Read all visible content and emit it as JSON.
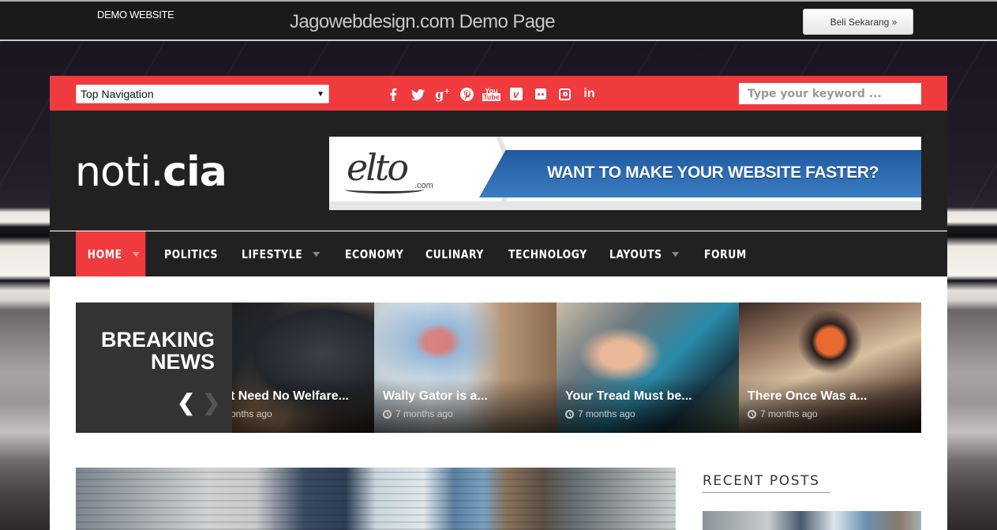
{
  "demo_bar": {
    "label": "DEMO WEBSITE",
    "title": "Jagowebdesign.com Demo Page",
    "buy_button": "Beli Sekarang »"
  },
  "topbar": {
    "nav_select": "Top Navigation",
    "social_icons": [
      "facebook-icon",
      "twitter-icon",
      "google-plus-icon",
      "pinterest-icon",
      "youtube-icon",
      "vimeo-icon",
      "flickr-icon",
      "instagram-icon",
      "linkedin-icon"
    ],
    "search_placeholder": "Type your keyword ...",
    "accent_color": "#ef3a3e"
  },
  "header": {
    "logo_light": "noti.",
    "logo_bold": "cia",
    "ad": {
      "brand": "elto",
      "brand_suffix": ".com",
      "headline": "WANT TO MAKE YOUR WEBSITE FASTER?"
    }
  },
  "nav": {
    "items": [
      {
        "label": "HOME",
        "dropdown": true,
        "active": true
      },
      {
        "label": "POLITICS",
        "dropdown": false
      },
      {
        "label": "LIFESTYLE",
        "dropdown": true
      },
      {
        "label": "ECONOMY",
        "dropdown": false
      },
      {
        "label": "CULINARY",
        "dropdown": false
      },
      {
        "label": "TECHNOLOGY",
        "dropdown": false
      },
      {
        "label": "LAYOUTS",
        "dropdown": true
      },
      {
        "label": "FORUM",
        "dropdown": false
      }
    ]
  },
  "breaking": {
    "title_line1": "BREAKING",
    "title_line2": "NEWS",
    "prev": "‹",
    "next": "›",
    "slides": [
      {
        "title": "t Need No Welfare...",
        "date": "onths ago"
      },
      {
        "title": "Wally Gator is a...",
        "date": "7 months ago"
      },
      {
        "title": "Your Tread Must be...",
        "date": "7 months ago"
      },
      {
        "title": "There Once Was a...",
        "date": "7 months ago"
      }
    ]
  },
  "sidebar": {
    "recent_posts_title": "RECENT POSTS"
  }
}
